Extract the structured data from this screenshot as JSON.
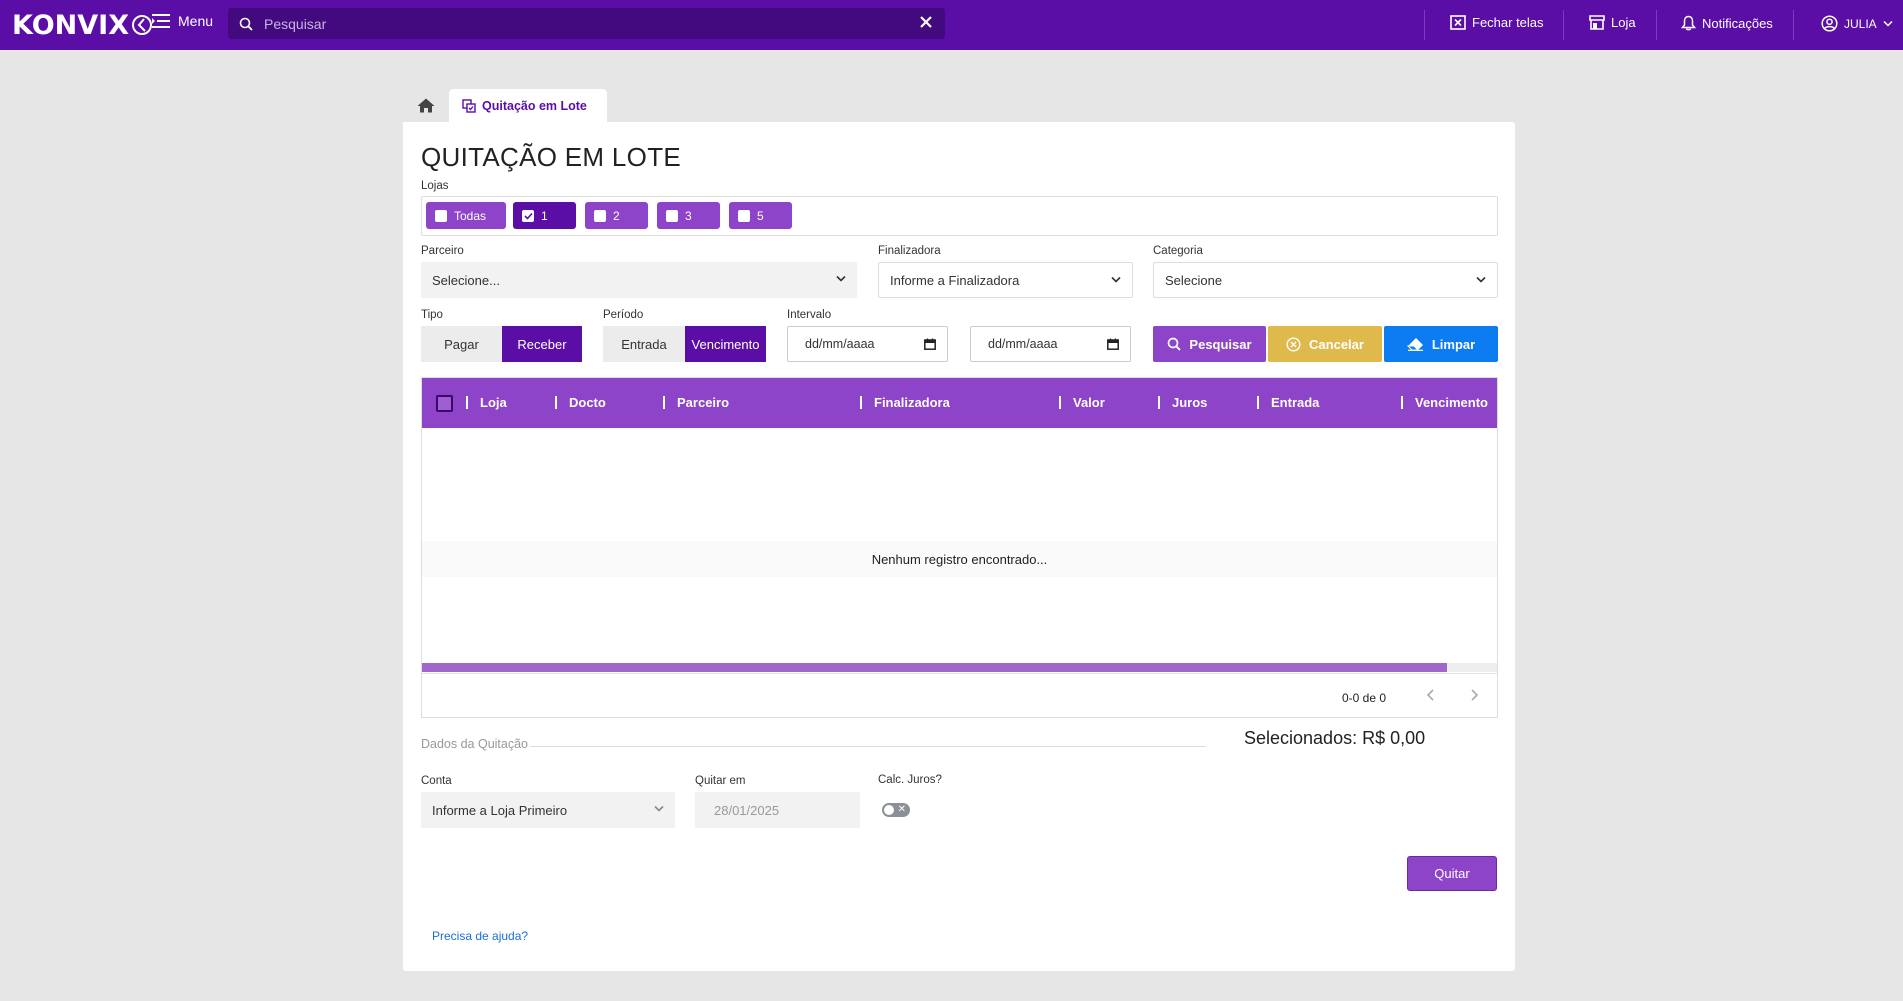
{
  "topbar": {
    "logo": "KONVIX",
    "menu_label": "Menu",
    "search_placeholder": "Pesquisar",
    "fechar_telas": "Fechar telas",
    "loja": "Loja",
    "notificacoes": "Notificações",
    "user": "JULIA"
  },
  "tabs": {
    "active_label": "Quitação em Lote"
  },
  "page": {
    "title": "QUITAÇÃO EM LOTE",
    "lojas_label": "Lojas",
    "lojas": [
      {
        "label": "Todas",
        "selected": false
      },
      {
        "label": "1",
        "selected": true
      },
      {
        "label": "2",
        "selected": false
      },
      {
        "label": "3",
        "selected": false
      },
      {
        "label": "5",
        "selected": false
      }
    ],
    "parceiro_label": "Parceiro",
    "parceiro_value": "Selecione...",
    "finalizadora_label": "Finalizadora",
    "finalizadora_value": "Informe a Finalizadora",
    "categoria_label": "Categoria",
    "categoria_value": "Selecione",
    "tipo_label": "Tipo",
    "tipo_options": [
      "Pagar",
      "Receber"
    ],
    "tipo_selected": "Receber",
    "periodo_label": "Período",
    "periodo_options": [
      "Entrada",
      "Vencimento"
    ],
    "periodo_selected": "Vencimento",
    "intervalo_label": "Intervalo",
    "date_from": "dd/mm/aaaa",
    "date_to": "dd/mm/aaaa",
    "btn_pesquisar": "Pesquisar",
    "btn_cancelar": "Cancelar",
    "btn_limpar": "Limpar"
  },
  "table": {
    "columns": [
      "Loja",
      "Docto",
      "Parceiro",
      "Finalizadora",
      "Valor",
      "Juros",
      "Entrada",
      "Vencimento"
    ],
    "empty_message": "Nenhum registro encontrado...",
    "pagination": "0-0 de 0"
  },
  "quitacao": {
    "section_label": "Dados da Quitação",
    "selected_total": "Selecionados: R$ 0,00",
    "conta_label": "Conta",
    "conta_value": "Informe a Loja Primeiro",
    "quitar_em_label": "Quitar em",
    "quitar_em_value": "28/01/2025",
    "calc_juros_label": "Calc. Juros?",
    "calc_juros_on": false,
    "btn_quitar": "Quitar",
    "help_link": "Precisa de ajuda?"
  },
  "colors": {
    "topbar": "#5b0ea6",
    "purple_light": "#8e44c9",
    "yellow": "#e0b94c",
    "blue": "#0d7bf2"
  }
}
